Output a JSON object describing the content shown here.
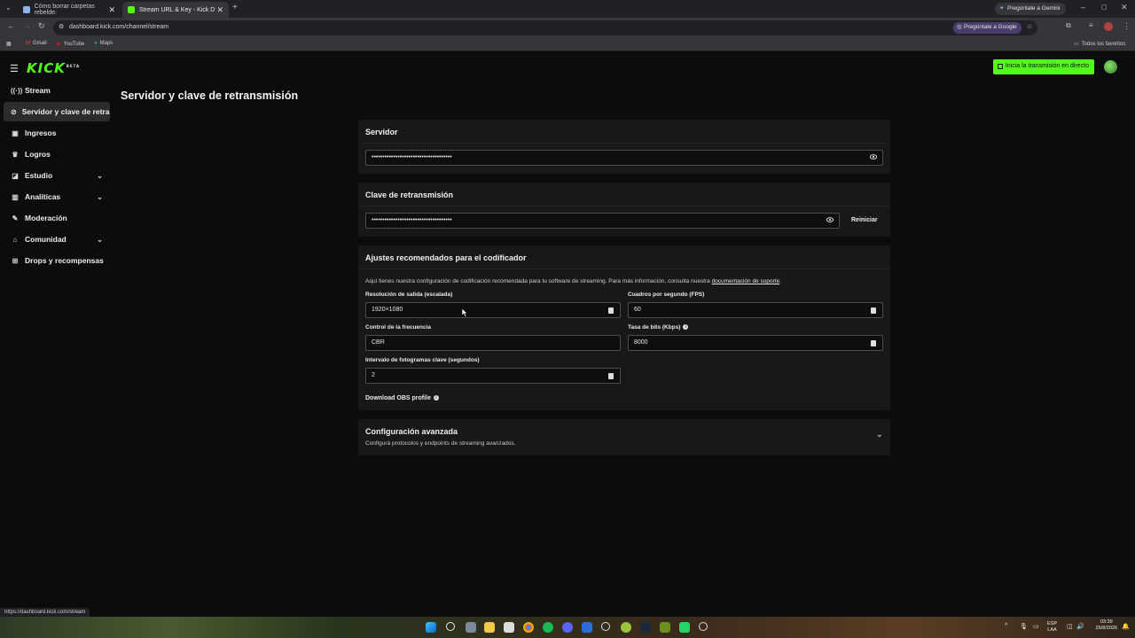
{
  "browser": {
    "tabs": [
      {
        "label": "Cómo borrar carpetas rebelde:",
        "active": false
      },
      {
        "label": "Stream URL & Key - Kick D",
        "active": true
      }
    ],
    "gemini_label": "Pregúntale a Gemini",
    "url": "dashboard.kick.com/channel/stream",
    "ask_google": "Pregúntale a Google",
    "bookmarks": [
      "Gmail",
      "YouTube",
      "Maps"
    ],
    "all_bookmarks": "Todos los favoritos",
    "status_url": "https://dashboard.kick.com/stream"
  },
  "header": {
    "logo": "KICK",
    "logo_tag": "BETA",
    "go_live_label": "Inicia la transmisión en directo"
  },
  "sidebar": {
    "items": [
      {
        "label": "Stream",
        "icon": "broadcast-icon"
      },
      {
        "label": "Servidor y clave de retran",
        "icon": "link-icon",
        "active": true
      },
      {
        "label": "Ingresos",
        "icon": "wallet-icon"
      },
      {
        "label": "Logros",
        "icon": "trophy-icon"
      },
      {
        "label": "Estudio",
        "icon": "studio-icon",
        "expandable": true
      },
      {
        "label": "Analíticas",
        "icon": "chart-icon",
        "expandable": true
      },
      {
        "label": "Moderación",
        "icon": "wrench-icon"
      },
      {
        "label": "Comunidad",
        "icon": "community-icon",
        "expandable": true
      },
      {
        "label": "Drops y recompensas",
        "icon": "gift-icon"
      }
    ]
  },
  "main": {
    "title": "Servidor y clave de retransmisión",
    "server": {
      "heading": "Servidor",
      "value": "•••••••••••••••••••••••••••••••••••••"
    },
    "stream_key": {
      "heading": "Clave de retransmisión",
      "value": "•••••••••••••••••••••••••••••••••••••",
      "reset_label": "Reiniciar"
    },
    "encoder": {
      "heading": "Ajustes recomendados para el codificador",
      "description": "Aquí tienes nuestra configuración de codificación recomendada para tu software de streaming. Para más información, consulta nuestra ",
      "description_link": "documentación de soporte",
      "description_end": ".",
      "resolution_label": "Resolución de salida (escalada)",
      "resolution_value": "1920×1080",
      "fps_label": "Cuadros por segundo (FPS)",
      "fps_value": "60",
      "rate_control_label": "Control de la frecuencia",
      "rate_control_value": "CBR",
      "bitrate_label": "Tasa de bits (Kbps)",
      "bitrate_value": "8000",
      "keyframe_label": "Intervalo de fotogramas clave (segundos)",
      "keyframe_value": "2",
      "obs_label": "Download OBS profile"
    },
    "advanced": {
      "heading": "Configuración avanzada",
      "subtitle": "Configurá protocolos y endpoints de streaming avanzados."
    }
  },
  "taskbar": {
    "lang_top": "ESP",
    "lang_bottom": "LAA",
    "time": "03:39",
    "date": "25/8/2026"
  }
}
